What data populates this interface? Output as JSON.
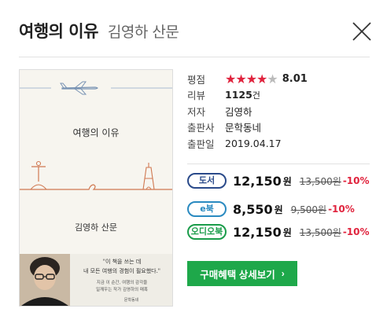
{
  "header": {
    "title": "여행의 이유",
    "subtitle": "김영하 산문"
  },
  "cover": {
    "book_title": "여행의 이유",
    "author": "김영하 산문",
    "quote_line1": "\"이 책을 쓰는 데",
    "quote_line2": "내 모든 여행의 경험이 필요했다.\"",
    "blurb_line1": "지금 이 순간, 여행의 감각을",
    "blurb_line2": "일깨우는 작가 김영하의 매혹",
    "publisher_logo": "문학동네"
  },
  "info": {
    "rating_label": "평점",
    "rating_stars_filled": 4,
    "rating_stars_total": 5,
    "rating_value": "8.01",
    "review_label": "리뷰",
    "review_count": "1125",
    "review_unit": "건",
    "author_label": "저자",
    "author_value": "김영하",
    "publisher_label": "출판사",
    "publisher_value": "문학동네",
    "date_label": "출판일",
    "date_value": "2019.04.17"
  },
  "prices": [
    {
      "badge": "도서",
      "price": "12,150",
      "unit": "원",
      "original": "13,500원",
      "discount": "-10%"
    },
    {
      "badge": "e북",
      "price": "8,550",
      "unit": "원",
      "original": "9,500원",
      "discount": "-10%"
    },
    {
      "badge": "오디오북",
      "price": "12,150",
      "unit": "원",
      "original": "13,500원",
      "discount": "-10%"
    }
  ],
  "buy_button": {
    "label": "구매혜택 상세보기",
    "chevron": "›"
  },
  "colors": {
    "star": "#e0233d",
    "discount": "#e0233d",
    "buy_button": "#1ea84a",
    "badge_book": "#2a4a8a",
    "badge_ebook": "#2a8ac0",
    "badge_audio": "#1a9c4a"
  },
  "icons": [
    "close-icon",
    "airplane-icon",
    "christ-statue-icon",
    "eiffel-tower-icon",
    "star-icon"
  ]
}
